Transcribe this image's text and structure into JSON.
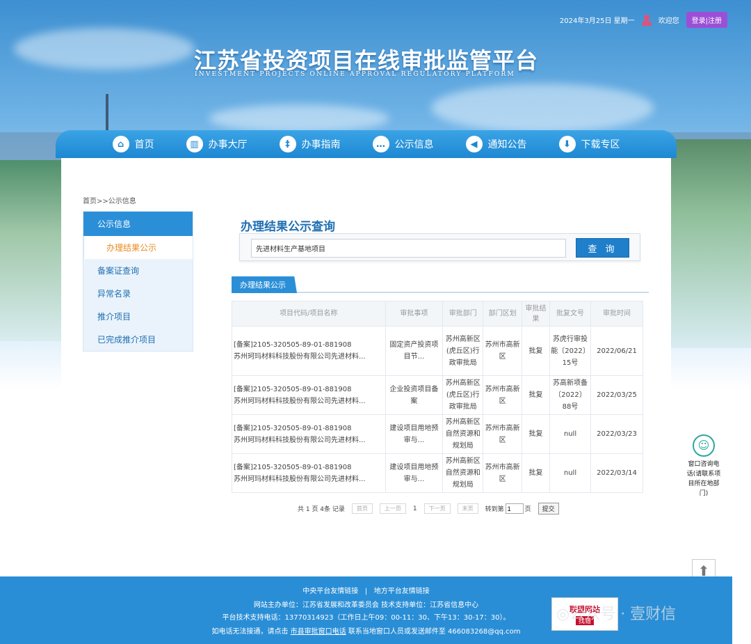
{
  "header": {
    "date": "2024年3月25日 星期一",
    "welcome": "欢迎您",
    "login_label": "登录|注册",
    "site_title": "江苏省投资项目在线审批监管平台",
    "site_subtitle": "INVESTMENT PROJECTS ONLINE APPROVAL REGULATORY PLATFORM"
  },
  "nav": [
    {
      "label": "首页",
      "icon": "home-icon",
      "glyph": "⌂"
    },
    {
      "label": "办事大厅",
      "icon": "book-icon",
      "glyph": "▥"
    },
    {
      "label": "办事指南",
      "icon": "guide-icon",
      "glyph": "‡"
    },
    {
      "label": "公示信息",
      "icon": "message-icon",
      "glyph": "…"
    },
    {
      "label": "通知公告",
      "icon": "speaker-icon",
      "glyph": "◀"
    },
    {
      "label": "下载专区",
      "icon": "download-icon",
      "glyph": "⬇"
    }
  ],
  "breadcrumb": "首页>>公示信息",
  "sidebar": {
    "head": "公示信息",
    "sub": "办理结果公示",
    "items": [
      "备案证查询",
      "异常名录",
      "推介项目",
      "已完成推介项目"
    ]
  },
  "panel": {
    "title": "办理结果公示查询",
    "search_value": "先进材料生产基地项目",
    "search_button": "查 询",
    "tab": "办理结果公示"
  },
  "table": {
    "headers": [
      "项目代码/项目名称",
      "审批事项",
      "审批部门",
      "部门区划",
      "审批结果",
      "批复文号",
      "审批时间"
    ],
    "rows": [
      {
        "code": "[备案]2105-320505-89-01-881908",
        "name": "苏州珂玛材料科技股份有限公司先进材料...",
        "item": "固定资产投资项目节...",
        "dept": "苏州高新区(虎丘区)行政审批局",
        "region": "苏州市高新区",
        "result": "批复",
        "doc": "苏虎行审投能〔2022〕15号",
        "date": "2022/06/21"
      },
      {
        "code": "[备案]2105-320505-89-01-881908",
        "name": "苏州珂玛材料科技股份有限公司先进材料...",
        "item": "企业投资项目备案",
        "dept": "苏州高新区(虎丘区)行政审批局",
        "region": "苏州市高新区",
        "result": "批复",
        "doc": "苏高新项备〔2022〕88号",
        "date": "2022/03/25"
      },
      {
        "code": "[备案]2105-320505-89-01-881908",
        "name": "苏州珂玛材料科技股份有限公司先进材料...",
        "item": "建设项目用地预审与...",
        "dept": "苏州高新区自然资源和规划局",
        "region": "苏州市高新区",
        "result": "批复",
        "doc": "null",
        "date": "2022/03/23"
      },
      {
        "code": "[备案]2105-320505-89-01-881908",
        "name": "苏州珂玛材料科技股份有限公司先进材料...",
        "item": "建设项目用地预审与...",
        "dept": "苏州高新区自然资源和规划局",
        "region": "苏州市高新区",
        "result": "批复",
        "doc": "null",
        "date": "2022/03/14"
      }
    ]
  },
  "pager": {
    "summary": "共 1 页 4条 记录",
    "first": "首页",
    "prev": "上一页",
    "current": "1",
    "next": "下一页",
    "last": "末页",
    "goto_label": "转到第",
    "goto_value": "1",
    "page_unit": "页",
    "submit": "提交"
  },
  "float_help": "窗口咨询电话(请联系项目所在地部门)",
  "footer": {
    "links_a": "中央平台友情链接",
    "divider": "|",
    "links_b": "地方平台友情链接",
    "host": "网站主办单位：江苏省发展和改革委员会 技术支持单位：江苏省信息中心",
    "support": "平台技术支持电话：13770314923（工作日上午09：00-11：30、下午13：30-17：30）。",
    "contact_pre": "如电话无法接通，请点击",
    "contact_link": "市县审批窗口电话",
    "contact_post": "联系当地窗口人员或发送邮件至 466083268@qq.com",
    "badge_line1": "联盟网站",
    "badge_line2": "找错"
  },
  "watermark": "◎公众号 · 壹财信",
  "colors": {
    "primary": "#2b8fd8",
    "accent_orange": "#e88a1f",
    "login_purple": "#9b4fd6"
  }
}
